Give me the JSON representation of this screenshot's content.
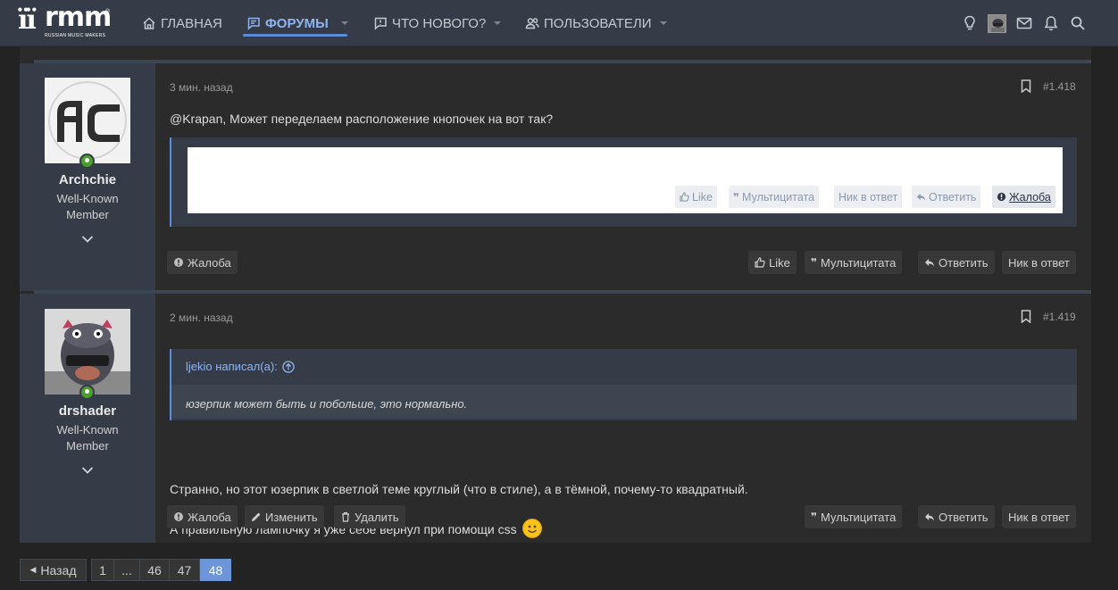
{
  "brand": {
    "logo_glyph": "ïï",
    "logo_word": "rmm",
    "logo_tagline": "RUSSIAN MUSIC MAKERS",
    "registered": "®"
  },
  "nav": {
    "items": [
      {
        "label": "ГЛАВНАЯ",
        "icon": "home-icon"
      },
      {
        "label": "ФОРУМЫ",
        "icon": "forum-icon",
        "active": true
      },
      {
        "label": "ЧТО НОВОГО?",
        "icon": "whats-new-icon"
      },
      {
        "label": "ПОЛЬЗОВАТЕЛИ",
        "icon": "users-icon"
      }
    ],
    "right_icons": [
      "lightbulb-icon",
      "avatar",
      "mail-icon",
      "bell-icon",
      "search-icon"
    ]
  },
  "colors": {
    "accent": "#5b8cd9",
    "nav_bg": "#353c47",
    "online": "#4aa02c",
    "page_current": "#6e95d8"
  },
  "posts": [
    {
      "user": {
        "name": "Archchie",
        "title_line1": "Well-Known",
        "title_line2": "Member",
        "avatar_text": "AC"
      },
      "time": "3 мин. назад",
      "number": "#1.418",
      "message": "@Krapan, Может переделаем расположение кнопочек на вот так?",
      "embed_buttons": [
        {
          "label": "Like",
          "icon": "thumbs-up-icon"
        },
        {
          "label": "Мультицитата",
          "icon": "quote-icon"
        },
        {
          "label": "Ник в ответ",
          "icon": ""
        },
        {
          "label": "Ответить",
          "icon": "reply-icon"
        },
        {
          "label": "Жалоба",
          "icon": "report-icon"
        }
      ],
      "actions_left": [
        {
          "label": "Жалоба",
          "icon": "report-icon"
        }
      ],
      "actions_right": [
        {
          "label": "Like",
          "icon": "thumbs-up-icon"
        },
        {
          "label": "Мультицитата",
          "icon": "quote-icon"
        },
        {
          "label": "Ответить",
          "icon": "reply-icon"
        },
        {
          "label": "Ник в ответ",
          "icon": ""
        }
      ]
    },
    {
      "user": {
        "name": "drshader",
        "title_line1": "Well-Known",
        "title_line2": "Member"
      },
      "time": "2 мин. назад",
      "number": "#1.419",
      "quote_author": "ljekio написал(а):",
      "quote_text": "юзерпик может быть и побольше, это нормально.",
      "paragraph1": "Странно, но этот юзерпик в светлой теме круглый (что в стиле), а в тёмной, почему-то квадратный.",
      "paragraph2": "А правильную лампочку я уже себе вернул при помощи css",
      "actions_left": [
        {
          "label": "Жалоба",
          "icon": "report-icon"
        },
        {
          "label": "Изменить",
          "icon": "pencil-icon"
        },
        {
          "label": "Удалить",
          "icon": "trash-icon"
        }
      ],
      "actions_right": [
        {
          "label": "Мультицитата",
          "icon": "quote-icon"
        },
        {
          "label": "Ответить",
          "icon": "reply-icon"
        },
        {
          "label": "Ник в ответ",
          "icon": ""
        }
      ]
    }
  ],
  "pagination": {
    "prev_label": "Назад",
    "pages": [
      "1",
      "...",
      "46",
      "47",
      "48"
    ],
    "current": "48"
  }
}
